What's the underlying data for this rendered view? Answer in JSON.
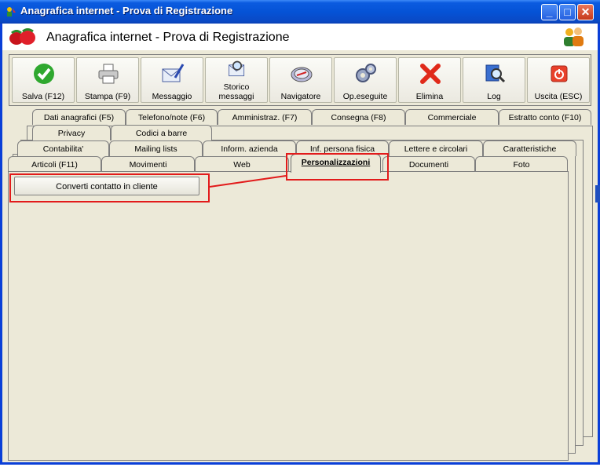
{
  "window": {
    "title": "Anagrafica internet - Prova di Registrazione",
    "header_title": "Anagrafica internet - Prova di Registrazione",
    "minimize_glyph": "_",
    "maximize_glyph": "□",
    "close_glyph": "✕"
  },
  "toolbar": [
    {
      "name": "save-button",
      "icon": "check-icon",
      "label": "Salva (F12)"
    },
    {
      "name": "print-button",
      "icon": "printer-icon",
      "label": "Stampa (F9)"
    },
    {
      "name": "message-button",
      "icon": "envelope-pen-icon",
      "label": "Messaggio"
    },
    {
      "name": "message-history-button",
      "icon": "envelope-search-icon",
      "label": "Storico messaggi"
    },
    {
      "name": "navigator-button",
      "icon": "compass-icon",
      "label": "Navigatore"
    },
    {
      "name": "operations-done-button",
      "icon": "gears-icon",
      "label": "Op.eseguite"
    },
    {
      "name": "delete-button",
      "icon": "red-x-icon",
      "label": "Elimina"
    },
    {
      "name": "log-button",
      "icon": "book-magnifier-icon",
      "label": "Log"
    },
    {
      "name": "exit-button",
      "icon": "power-icon",
      "label": "Uscita (ESC)"
    }
  ],
  "tabs": {
    "row1": [
      "Dati anagrafici (F5)",
      "Telefono/note (F6)",
      "Amministraz. (F7)",
      "Consegna (F8)",
      "Commerciale",
      "Estratto conto (F10)"
    ],
    "row2": [
      "Privacy",
      "Codici a barre"
    ],
    "row3": [
      "Contabilita'",
      "Mailing lists",
      "Inform. azienda",
      "Inf. persona fisica",
      "Lettere e circolari",
      "Caratteristiche"
    ],
    "row4": [
      "Articoli (F11)",
      "Movimenti",
      "Web",
      "Personalizzazioni",
      "Documenti",
      "Foto"
    ],
    "active": "Personalizzazioni"
  },
  "panel": {
    "convert_button_label": "Converti contatto in cliente"
  },
  "colors": {
    "titlebar": "#0553d6",
    "highlight": "#e21b1b",
    "face": "#ece9d8"
  }
}
